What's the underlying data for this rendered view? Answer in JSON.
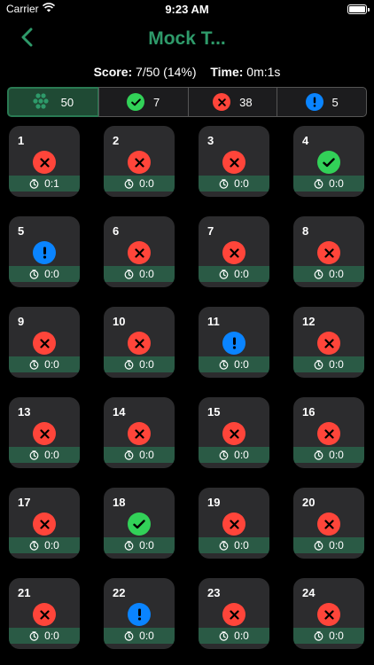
{
  "status_bar": {
    "carrier": "Carrier",
    "time": "9:23 AM"
  },
  "nav": {
    "title": "Mock T..."
  },
  "score": {
    "score_label": "Score:",
    "score_value": "7/50 (14%)",
    "time_label": "Time:",
    "time_value": "0m:1s"
  },
  "tabs": [
    {
      "icon": "grid-dots-icon",
      "count": "50",
      "active": true
    },
    {
      "icon": "check-icon",
      "count": "7",
      "active": false
    },
    {
      "icon": "cross-icon",
      "count": "38",
      "active": false
    },
    {
      "icon": "exclamation-icon",
      "count": "5",
      "active": false
    }
  ],
  "colors": {
    "accent": "#2e9a6a",
    "wrong": "#ff453a",
    "correct": "#32d158",
    "skipped": "#0a84ff",
    "card": "#2c2c2e",
    "time_bar": "#2a5a45"
  },
  "questions": [
    {
      "number": "1",
      "status": "wrong",
      "time": "0:1"
    },
    {
      "number": "2",
      "status": "wrong",
      "time": "0:0"
    },
    {
      "number": "3",
      "status": "wrong",
      "time": "0:0"
    },
    {
      "number": "4",
      "status": "correct",
      "time": "0:0"
    },
    {
      "number": "5",
      "status": "skipped",
      "time": "0:0"
    },
    {
      "number": "6",
      "status": "wrong",
      "time": "0:0"
    },
    {
      "number": "7",
      "status": "wrong",
      "time": "0:0"
    },
    {
      "number": "8",
      "status": "wrong",
      "time": "0:0"
    },
    {
      "number": "9",
      "status": "wrong",
      "time": "0:0"
    },
    {
      "number": "10",
      "status": "wrong",
      "time": "0:0"
    },
    {
      "number": "11",
      "status": "skipped",
      "time": "0:0"
    },
    {
      "number": "12",
      "status": "wrong",
      "time": "0:0"
    },
    {
      "number": "13",
      "status": "wrong",
      "time": "0:0"
    },
    {
      "number": "14",
      "status": "wrong",
      "time": "0:0"
    },
    {
      "number": "15",
      "status": "wrong",
      "time": "0:0"
    },
    {
      "number": "16",
      "status": "wrong",
      "time": "0:0"
    },
    {
      "number": "17",
      "status": "wrong",
      "time": "0:0"
    },
    {
      "number": "18",
      "status": "correct",
      "time": "0:0"
    },
    {
      "number": "19",
      "status": "wrong",
      "time": "0:0"
    },
    {
      "number": "20",
      "status": "wrong",
      "time": "0:0"
    },
    {
      "number": "21",
      "status": "wrong",
      "time": "0:0"
    },
    {
      "number": "22",
      "status": "skipped",
      "time": "0:0"
    },
    {
      "number": "23",
      "status": "wrong",
      "time": "0:0"
    },
    {
      "number": "24",
      "status": "wrong",
      "time": "0:0"
    }
  ]
}
